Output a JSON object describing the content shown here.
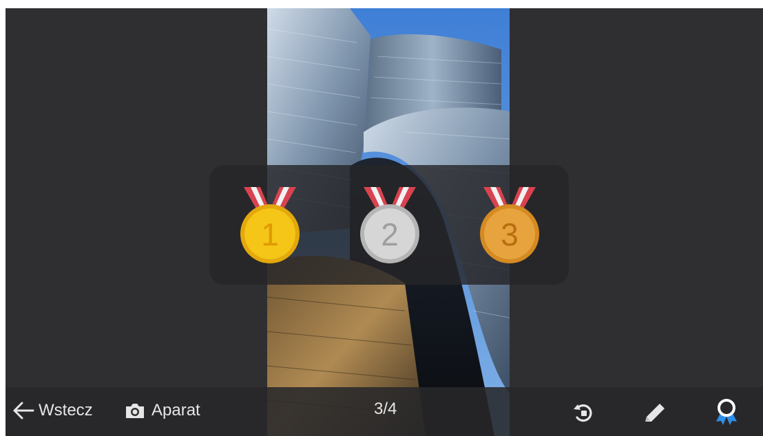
{
  "photo": {
    "sky_color": "#5a8fd0",
    "metal_color": "#9fb3c8",
    "gold_color": "#b08a52"
  },
  "medals": [
    {
      "number": "1",
      "color": "#f5c518"
    },
    {
      "number": "2",
      "color": "#d6d6d6"
    },
    {
      "number": "3",
      "color": "#e7a33e"
    }
  ],
  "bottom_bar": {
    "back_label": "Wstecz",
    "camera_label": "Aparat",
    "counter": "3/4",
    "icons": [
      "back-arrow-icon",
      "camera-icon",
      "rotate-icon",
      "pencil-icon",
      "award-ribbon-icon"
    ],
    "award_color": "#2f8fe8"
  }
}
